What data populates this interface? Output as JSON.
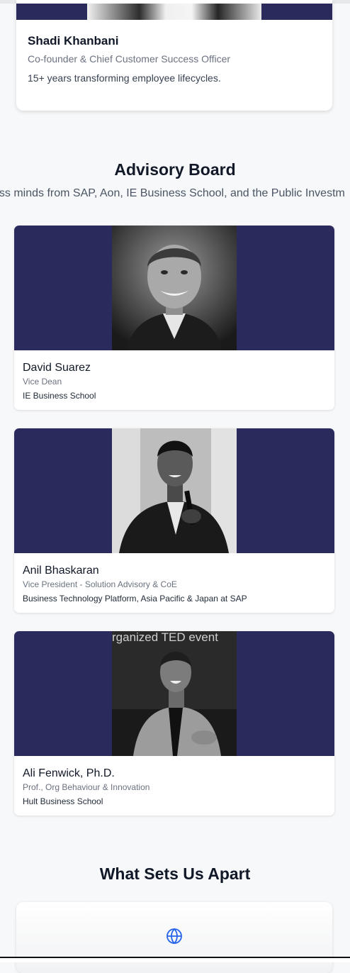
{
  "founder": {
    "name": "Shadi Khanbani",
    "role": "Co-founder & Chief Customer Success Officer",
    "description": "15+ years transforming employee lifecycles."
  },
  "advisory": {
    "title": "Advisory Board",
    "subtitle": "ass minds from SAP, Aon, IE Business School, and the Public Investm",
    "members": [
      {
        "name": "David Suarez",
        "title": "Vice Dean",
        "org": "IE Business School"
      },
      {
        "name": "Anil Bhaskaran",
        "title": "Vice President - Solution Advisory & CoE",
        "org": "Business Technology Platform, Asia Pacific & Japan at SAP"
      },
      {
        "name": "Ali Fenwick, Ph.D.",
        "title": "Prof., Org Behaviour & Innovation",
        "org": "Hult Business School",
        "photo_caption": "rganized TED event"
      }
    ]
  },
  "apart": {
    "title": "What Sets Us Apart",
    "icon": "globe-icon"
  },
  "colors": {
    "card_banner": "#2b2a5c",
    "accent_blue": "#2563eb",
    "background": "#f7f8fa"
  }
}
